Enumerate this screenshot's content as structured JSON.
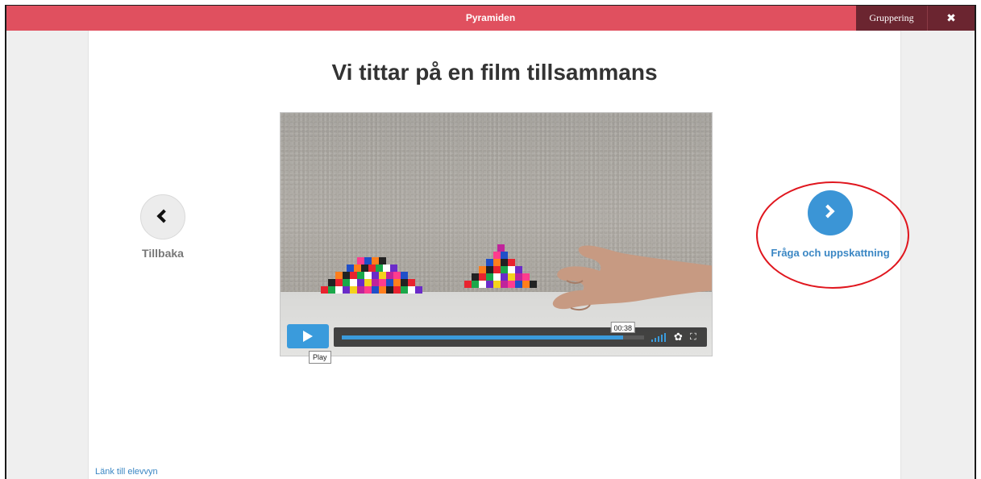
{
  "topbar": {
    "title": "Pyramiden",
    "group_button": "Gruppering",
    "close_button": "✖"
  },
  "main": {
    "heading": "Vi tittar på en film tillsammans",
    "back_label": "Tillbaka",
    "next_label": "Fråga och uppskattning",
    "student_link": "Länk till elevvyn"
  },
  "video": {
    "current_time": "00:38",
    "progress_fraction": 0.93,
    "play_tooltip": "Play",
    "accent_color": "#3a9bdc"
  },
  "colors": {
    "topbar": "#e0505f",
    "topbar_dark": "#6b2530",
    "next_button": "#3b95d6",
    "link": "#3b87c4",
    "highlight": "#e0161e"
  },
  "icons": {
    "back": "chevron-left-icon",
    "next": "chevron-right-icon",
    "close": "close-icon",
    "play": "play-icon",
    "volume": "volume-icon",
    "settings": "gear-icon",
    "fullscreen": "fullscreen-icon"
  }
}
